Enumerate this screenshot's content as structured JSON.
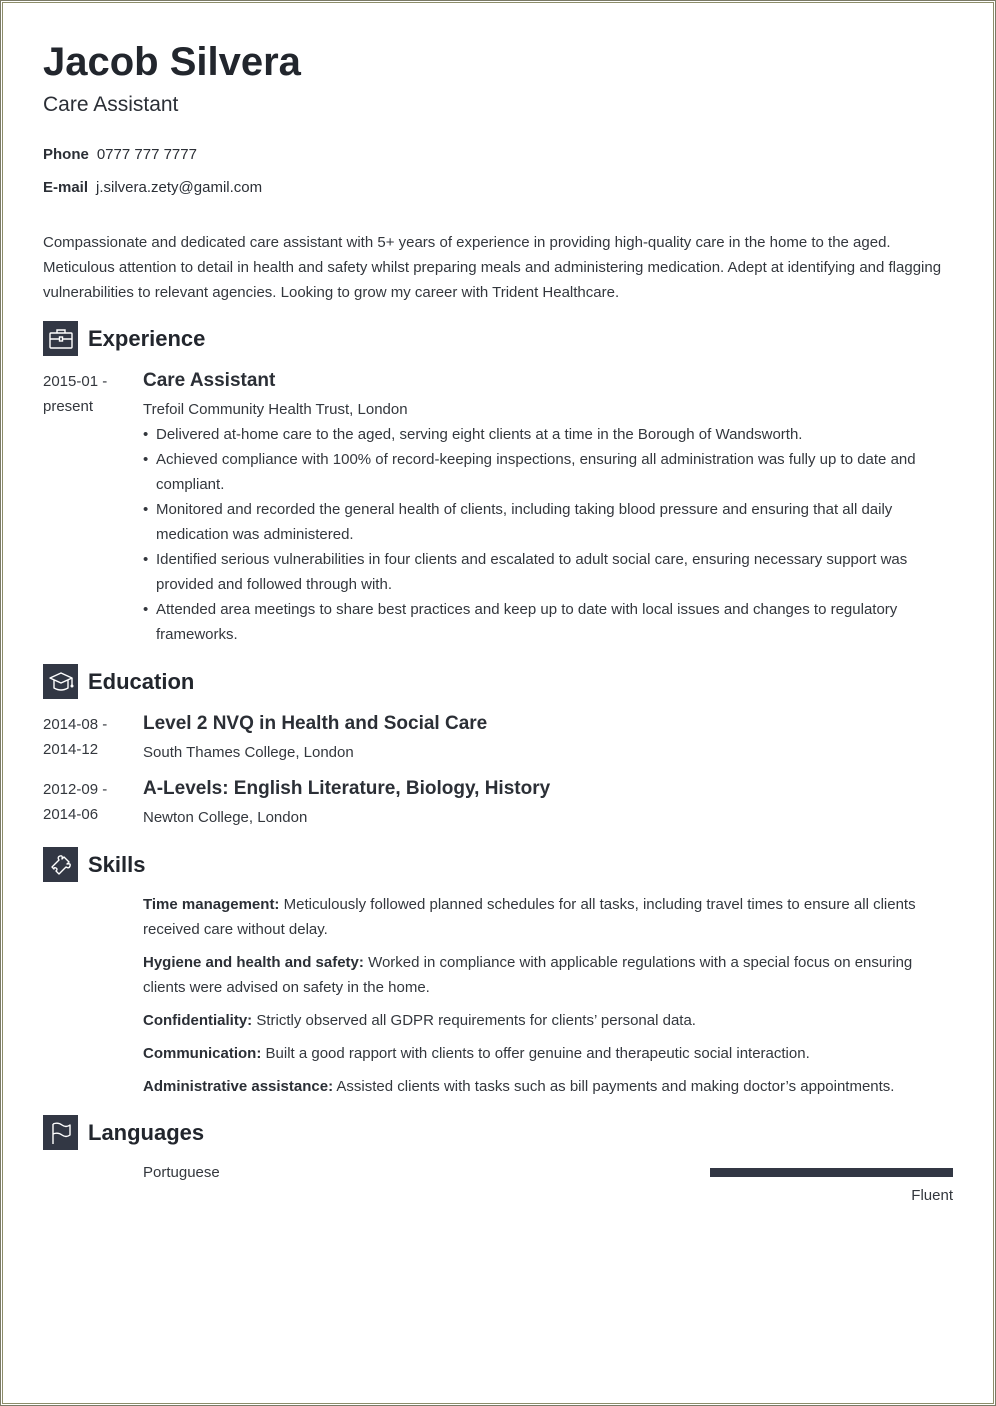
{
  "header": {
    "name": "Jacob Silvera",
    "title": "Care Assistant",
    "phone_label": "Phone",
    "phone": "0777 777 7777",
    "email_label": "E-mail",
    "email": "j.silvera.zety@gamil.com"
  },
  "summary": "Compassionate and dedicated care assistant with 5+ years of experience in providing high-quality care in the home to the aged. Meticulous attention to detail in health and safety whilst preparing meals and administering medication. Adept at identifying and flagging vulnerabilities to relevant agencies. Looking to grow my career with Trident Healthcare.",
  "sections": {
    "experience": {
      "title": "Experience",
      "icon": "briefcase-icon"
    },
    "education": {
      "title": "Education",
      "icon": "graduation-cap-icon"
    },
    "skills": {
      "title": "Skills",
      "icon": "puzzle-piece-icon"
    },
    "languages": {
      "title": "Languages",
      "icon": "flag-icon"
    }
  },
  "experience": [
    {
      "date_start": "2015-01 -",
      "date_end": "present",
      "title": "Care Assistant",
      "employer": "Trefoil Community Health Trust, London",
      "bullets": [
        "Delivered at-home care to the aged, serving eight clients at a time in the Borough of Wandsworth.",
        "Achieved compliance with 100% of record-keeping inspections, ensuring all administration was fully up to date and compliant.",
        "Monitored and recorded the general health of clients, including taking blood pressure and ensuring that all daily medication was administered.",
        "Identified serious vulnerabilities in four clients and escalated to adult social care, ensuring necessary support was provided and followed through with.",
        "Attended area meetings to share best practices and keep up to date with local issues and changes to regulatory frameworks."
      ]
    }
  ],
  "education": [
    {
      "date_start": "2014-08 -",
      "date_end": "2014-12",
      "title": "Level 2 NVQ in Health and Social Care",
      "school": "South Thames College, London"
    },
    {
      "date_start": "2012-09 -",
      "date_end": "2014-06",
      "title": "A-Levels: English Literature, Biology, History",
      "school": "Newton College, London"
    }
  ],
  "skills": [
    {
      "name": "Time management:",
      "desc": "Meticulously followed planned schedules for all tasks, including travel times to ensure all clients received care without delay."
    },
    {
      "name": "Hygiene and health and safety:",
      "desc": "Worked in compliance with applicable regulations with a special focus on ensuring clients were advised on safety in the home."
    },
    {
      "name": "Confidentiality:",
      "desc": "Strictly observed all GDPR requirements for clients’ personal data."
    },
    {
      "name": "Communication:",
      "desc": "Built a good rapport with clients to offer genuine and therapeutic social interaction."
    },
    {
      "name": "Administrative assistance:",
      "desc": "Assisted clients with tasks such as bill payments and making doctor’s appointments."
    }
  ],
  "languages": [
    {
      "name": "Portuguese",
      "level": "Fluent",
      "proficiency_percent": 100
    }
  ]
}
